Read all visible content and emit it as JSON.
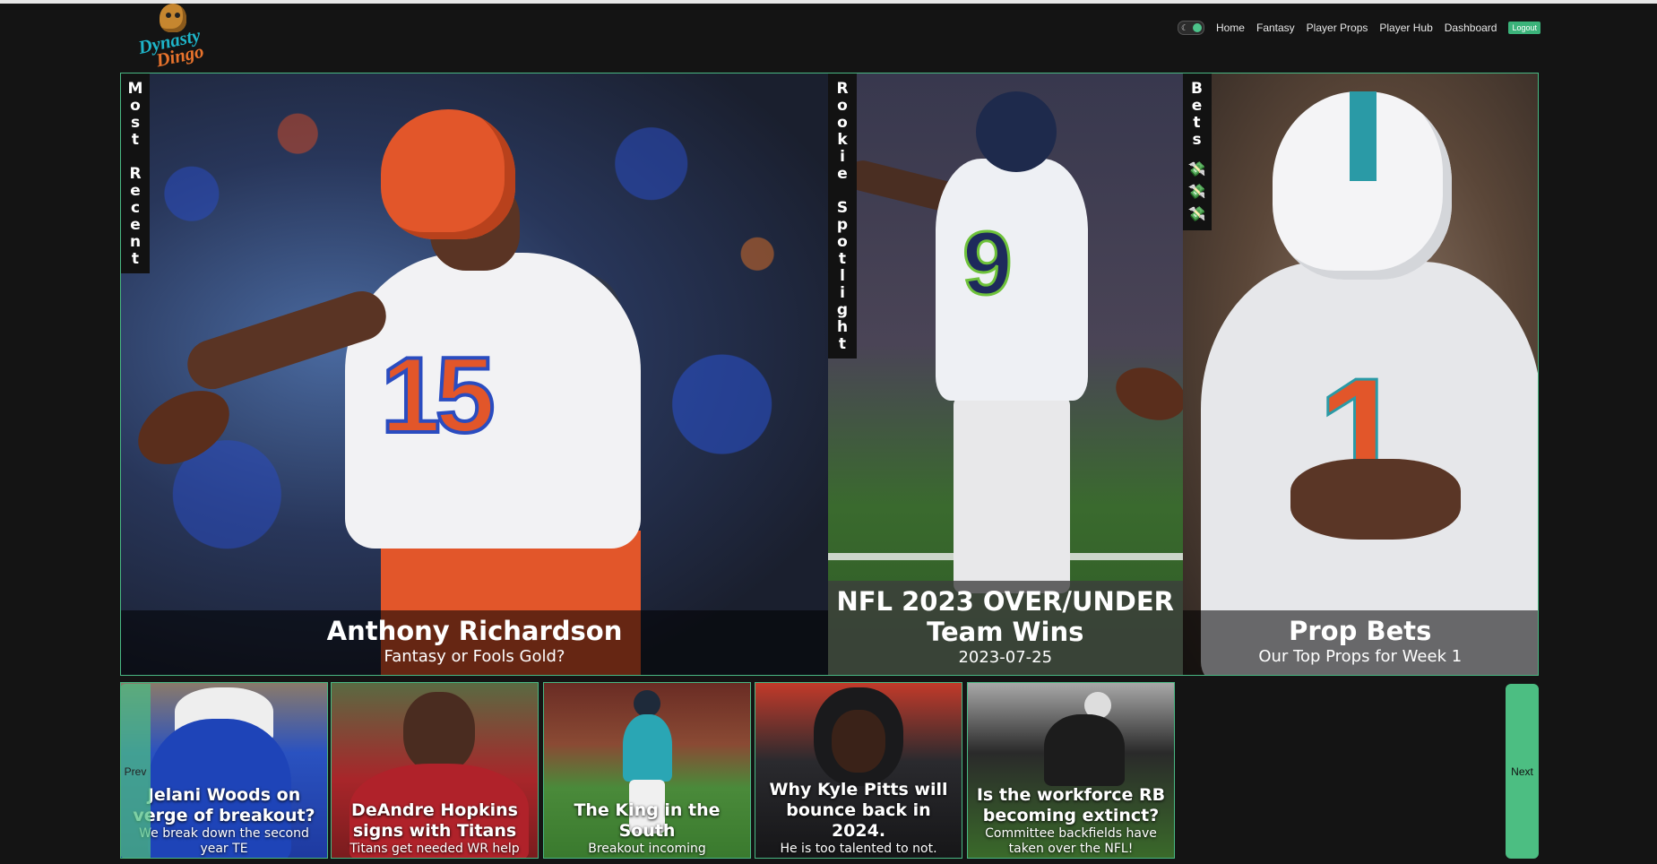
{
  "header": {
    "logo_text_1": "Dynasty",
    "logo_text_2": "Dingo",
    "nav": [
      "Home",
      "Fantasy",
      "Player Props",
      "Player Hub",
      "Dashboard"
    ],
    "logout_label": "Logout",
    "theme_toggle_icon": "moon-icon"
  },
  "hero": {
    "sections": [
      {
        "side_label": [
          "M",
          "o",
          "s",
          "t",
          " ",
          "R",
          "e",
          "c",
          "e",
          "n",
          "t"
        ],
        "title": "Anthony Richardson",
        "subtitle": "Fantasy or Fools Gold?"
      },
      {
        "side_label": [
          "R",
          "o",
          "o",
          "k",
          "i",
          "e",
          " ",
          "S",
          "p",
          "o",
          "t",
          "l",
          "i",
          "g",
          "h",
          "t"
        ],
        "title_line1": "NFL 2023 OVER/UNDER",
        "title_line2": "Team Wins",
        "subtitle": "2023-07-25"
      },
      {
        "side_label": [
          "B",
          "e",
          "t",
          "s"
        ],
        "side_icons": [
          "money-icon",
          "money-icon",
          "money-icon"
        ],
        "title": "Prop Bets",
        "subtitle": "Our Top Props for Week 1"
      }
    ]
  },
  "carousel": {
    "prev_label": "Prev",
    "next_label": "Next",
    "cards": [
      {
        "title": "Jelani Woods on verge of breakout?",
        "subtitle": "We break down the second year TE"
      },
      {
        "title": "DeAndre Hopkins signs with Titans",
        "subtitle": "Titans get needed WR help"
      },
      {
        "title": "The King in the South",
        "subtitle": "Breakout incoming"
      },
      {
        "title": "Why Kyle Pitts will bounce back in 2024.",
        "subtitle": "He is too talented to not."
      },
      {
        "title": "Is the workforce RB becoming extinct?",
        "subtitle": "Committee backfields have taken over the NFL!"
      }
    ]
  },
  "colors": {
    "accent": "#4cbe82",
    "background": "#141414"
  }
}
